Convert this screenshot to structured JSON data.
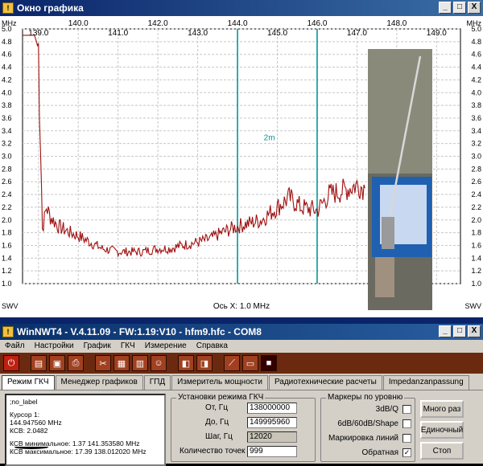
{
  "graph_window": {
    "title": "Окно графика",
    "controls": {
      "minimize": "_",
      "maximize": "□",
      "close": "X"
    }
  },
  "chart_data": {
    "type": "line",
    "x_unit": "MHz",
    "y_unit_label": "SWV",
    "x_top_ticks": [
      "139.0",
      "140.0",
      "141.0",
      "142.0",
      "143.0",
      "144.0",
      "145.0",
      "146.0",
      "147.0",
      "148.0",
      "149.0"
    ],
    "xlim": [
      138.6,
      149.6
    ],
    "ylim": [
      1.0,
      5.0
    ],
    "y_ticks": [
      "5.0",
      "4.8",
      "4.6",
      "4.4",
      "4.2",
      "4.0",
      "3.8",
      "3.6",
      "3.4",
      "3.2",
      "3.0",
      "2.8",
      "2.6",
      "2.4",
      "2.2",
      "2.0",
      "1.8",
      "1.6",
      "1.4",
      "1.2",
      "1.0"
    ],
    "x_axis_label": "Ось X: 1.0 MHz",
    "marker_label": "2m",
    "marker_lines_mhz": [
      144.0,
      146.0
    ],
    "series": [
      {
        "color": "#a01010",
        "x": [
          138.6,
          138.9,
          139.0,
          139.05,
          139.1,
          139.2,
          139.3,
          139.5,
          139.8,
          140.0,
          140.3,
          140.6,
          141.0,
          141.3,
          141.6,
          142.0,
          142.3,
          142.6,
          143.0,
          143.3,
          143.6,
          144.0,
          144.3,
          144.6,
          145.0,
          145.3,
          145.6,
          146.0,
          146.3,
          146.6,
          147.0,
          147.2
        ],
        "y": [
          4.9,
          4.9,
          4.7,
          3.4,
          1.85,
          2.2,
          2.05,
          1.9,
          1.8,
          1.75,
          1.65,
          1.55,
          1.5,
          1.5,
          1.5,
          1.55,
          1.55,
          1.6,
          1.65,
          1.7,
          1.8,
          1.9,
          1.95,
          2.0,
          2.2,
          2.35,
          2.2,
          2.15,
          2.4,
          2.45,
          2.55,
          2.5
        ]
      }
    ]
  },
  "main_window": {
    "title": "WinNWT4 - V.4.11.09 - FW:1.19:V10 - hfm9.hfc - COM8",
    "menu": [
      "Файл",
      "Настройки",
      "График",
      "ГКЧ",
      "Измерение",
      "Справка"
    ],
    "tabs": [
      "Режим ГКЧ",
      "Менеджер графиков",
      "ГПД",
      "Измеритель мощности",
      "Радиотехнические расчеты",
      "Impedanzanpassung"
    ],
    "info": {
      "label": ";no_label",
      "cursor": "Курсор 1:",
      "cursor_freq": "144.947560 MHz",
      "swr": "КСВ: 2.0482",
      "swr_min": "КСВ минимальное: 1.37  141.353580 MHz",
      "swr_max": "КСВ максимальное: 17.39  138.012020 MHz"
    },
    "sweep": {
      "legend": "Установки режима ГКЧ",
      "from_label": "От, Гц",
      "from_value": "138000000",
      "to_label": "До, Гц",
      "to_value": "149995960",
      "step_label": "Шаг, Гц",
      "step_value": "12020",
      "points_label": "Количество точек",
      "points_value": "999"
    },
    "markers": {
      "legend": "Маркеры по уровню",
      "items": [
        {
          "label": "3dB/Q",
          "checked": false
        },
        {
          "label": "6dB/60dB/Shape",
          "checked": false
        },
        {
          "label": "Маркировка линий",
          "checked": false
        },
        {
          "label": "Обратная",
          "checked": true
        }
      ]
    },
    "buttons": {
      "many": "Много раз",
      "single": "Единочный",
      "stop": "Стоп"
    }
  }
}
